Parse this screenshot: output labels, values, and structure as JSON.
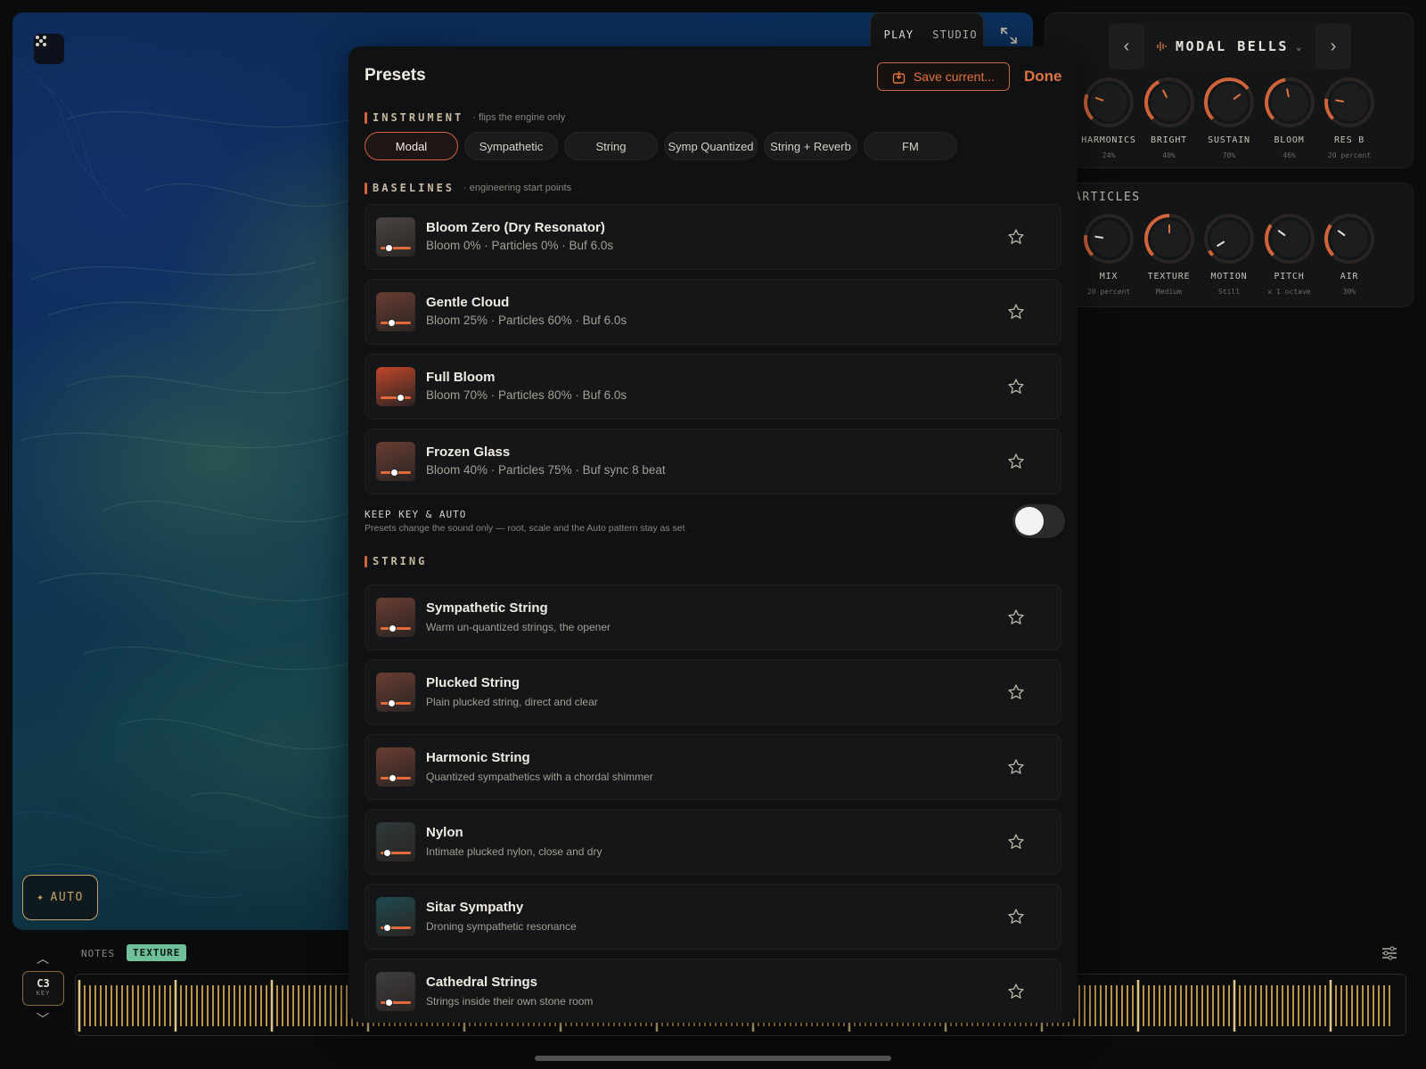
{
  "top": {
    "modes": [
      "PLAY",
      "STUDIO"
    ],
    "active_mode": "PLAY",
    "current_preset": "MODAL BELLS"
  },
  "engine_knobs": [
    {
      "label": "HARMONICS",
      "value": "24%",
      "level": 0.24
    },
    {
      "label": "BRIGHT",
      "value": "40%",
      "level": 0.4
    },
    {
      "label": "SUSTAIN",
      "value": "70%",
      "level": 0.7
    },
    {
      "label": "BLOOM",
      "value": "46%",
      "level": 0.46
    },
    {
      "label": "RES B",
      "value": "20 percent",
      "level": 0.2
    }
  ],
  "particles_section": "ARTICLES",
  "particle_knobs": [
    {
      "label": "MIX",
      "value": "20 percent",
      "level": 0.2
    },
    {
      "label": "TEXTURE",
      "value": "Medium",
      "level": 0.5
    },
    {
      "label": "MOTION",
      "value": "Still",
      "level": 0.05
    },
    {
      "label": "PITCH",
      "value": "x 1 octave",
      "level": 0.3
    },
    {
      "label": "AIR",
      "value": "30%",
      "level": 0.3
    }
  ],
  "modal": {
    "title": "Presets",
    "save_label": "Save current...",
    "done_label": "Done",
    "instrument": {
      "name": "INSTRUMENT",
      "hint": "· flips the engine only",
      "chips": [
        "Modal",
        "Sympathetic",
        "String",
        "Symp Quantized",
        "String + Reverb",
        "FM"
      ],
      "active": "Modal"
    },
    "baselines": {
      "name": "BASELINES",
      "hint": "· engineering start points",
      "items": [
        {
          "title": "Bloom Zero (Dry Resonator)",
          "sub": "Bloom 0% · Particles 0% · Buf 6.0s",
          "color": "#4a4544",
          "knob": 0.2
        },
        {
          "title": "Gentle Cloud",
          "sub": "Bloom 25% · Particles 60% · Buf 6.0s",
          "color": "#6a3d32",
          "knob": 0.3
        },
        {
          "title": "Full Bloom",
          "sub": "Bloom 70% · Particles 80% · Buf 6.0s",
          "color": "#c2462a",
          "knob": 0.7
        },
        {
          "title": "Frozen Glass",
          "sub": "Bloom 40% · Particles 75% · Buf sync 8 beat",
          "color": "#6a3d32",
          "knob": 0.45
        }
      ]
    },
    "keep": {
      "title": "KEEP KEY & AUTO",
      "desc": "Presets change the sound only — root, scale and the Auto pattern stay as set",
      "on": false
    },
    "string": {
      "name": "STRING",
      "items": [
        {
          "title": "Sympathetic String",
          "sub": "Warm un-quantized strings, the opener",
          "color": "#6a3d32",
          "knob": 0.35
        },
        {
          "title": "Plucked String",
          "sub": "Plain plucked string, direct and clear",
          "color": "#6a3d32",
          "knob": 0.3
        },
        {
          "title": "Harmonic String",
          "sub": "Quantized sympathetics with a chordal shimmer",
          "color": "#6a3d32",
          "knob": 0.35
        },
        {
          "title": "Nylon",
          "sub": "Intimate plucked nylon, close and dry",
          "color": "#2e3a3a",
          "knob": 0.1
        },
        {
          "title": "Sitar Sympathy",
          "sub": "Droning sympathetic resonance",
          "color": "#1e4a50",
          "knob": 0.1
        },
        {
          "title": "Cathedral Strings",
          "sub": "Strings inside their own stone room",
          "color": "#3e3e3e",
          "knob": 0.2
        }
      ]
    }
  },
  "bottom": {
    "tabs": [
      "NOTES",
      "TEXTURE"
    ],
    "active_tab": "TEXTURE",
    "key_value": "C3",
    "key_label": "KEY",
    "auto_label": "AUTO"
  },
  "colors": {
    "accent": "#e0743e",
    "gold": "#c9a066",
    "texture_tab": "#6fbf9a"
  }
}
